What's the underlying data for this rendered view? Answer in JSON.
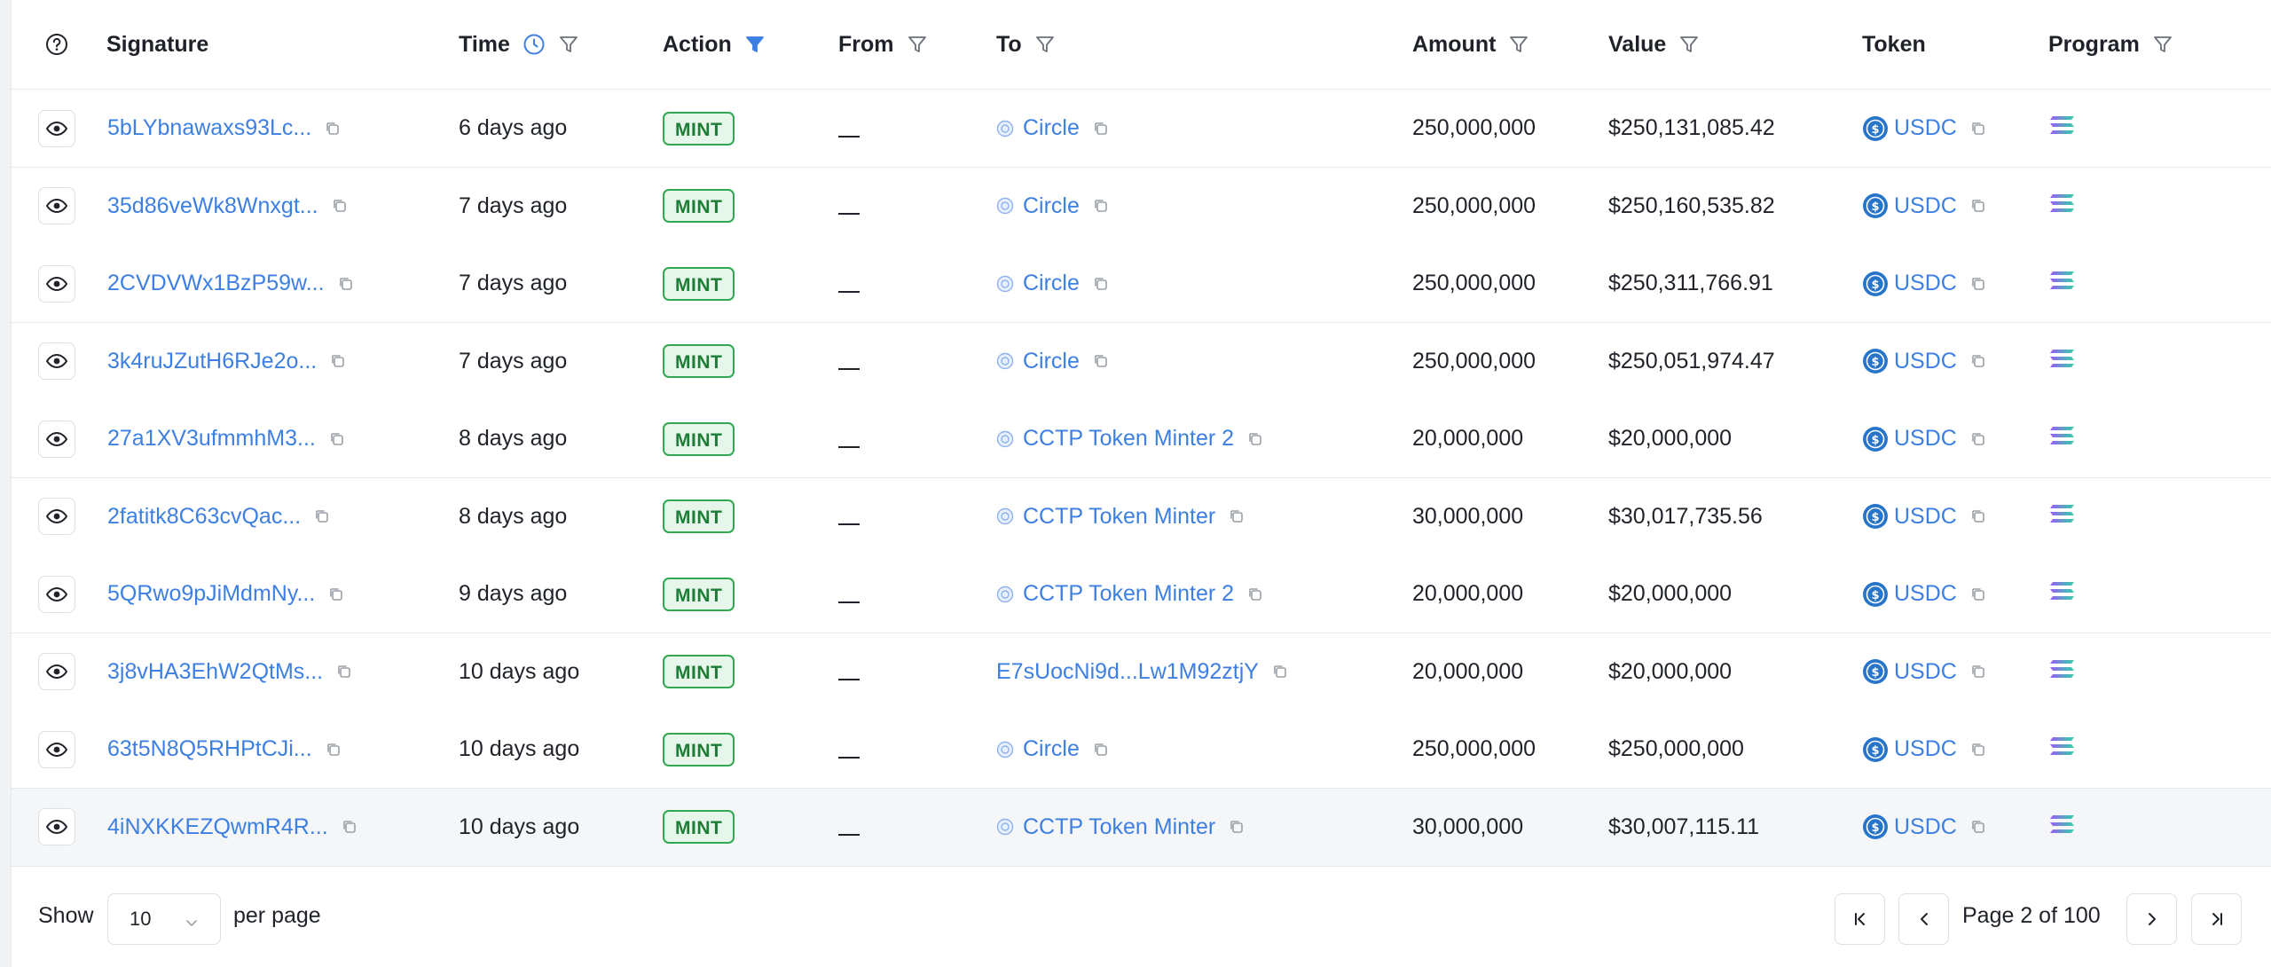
{
  "columns": {
    "signature": "Signature",
    "time": "Time",
    "action": "Action",
    "from": "From",
    "to": "To",
    "amount": "Amount",
    "value": "Value",
    "token": "Token",
    "program": "Program"
  },
  "icons": {
    "help": "help-circle-icon",
    "filter": "filter-icon",
    "filter_active": "filter-filled-icon",
    "clock": "clock-icon",
    "eye": "eye-icon",
    "copy": "copy-icon",
    "program": "solana-program-icon",
    "entity": "verified-entity-icon",
    "usdc": "usdc-token-icon"
  },
  "colors": {
    "link": "#3d7fe3",
    "badge_border": "#33a852",
    "badge_bg": "#e7f6ea",
    "filter_active": "#3d7fe3"
  },
  "rows": [
    {
      "signature": "5bLYbnawaxs93Lc...",
      "time": "6 days ago",
      "action": "MINT",
      "from": "__",
      "to": "Circle",
      "to_type": "entity",
      "amount": "250,000,000",
      "value": "$250,131,085.42",
      "token": "USDC"
    },
    {
      "signature": "35d86veWk8Wnxgt...",
      "time": "7 days ago",
      "action": "MINT",
      "from": "__",
      "to": "Circle",
      "to_type": "entity",
      "amount": "250,000,000",
      "value": "$250,160,535.82",
      "token": "USDC"
    },
    {
      "signature": "2CVDVWx1BzP59w...",
      "time": "7 days ago",
      "action": "MINT",
      "from": "__",
      "to": "Circle",
      "to_type": "entity",
      "amount": "250,000,000",
      "value": "$250,311,766.91",
      "token": "USDC"
    },
    {
      "signature": "3k4ruJZutH6RJe2o...",
      "time": "7 days ago",
      "action": "MINT",
      "from": "__",
      "to": "Circle",
      "to_type": "entity",
      "amount": "250,000,000",
      "value": "$250,051,974.47",
      "token": "USDC"
    },
    {
      "signature": "27a1XV3ufmmhM3...",
      "time": "8 days ago",
      "action": "MINT",
      "from": "__",
      "to": "CCTP Token Minter 2",
      "to_type": "entity",
      "amount": "20,000,000",
      "value": "$20,000,000",
      "token": "USDC"
    },
    {
      "signature": "2fatitk8C63cvQac...",
      "time": "8 days ago",
      "action": "MINT",
      "from": "__",
      "to": "CCTP Token Minter",
      "to_type": "entity",
      "amount": "30,000,000",
      "value": "$30,017,735.56",
      "token": "USDC"
    },
    {
      "signature": "5QRwo9pJiMdmNy...",
      "time": "9 days ago",
      "action": "MINT",
      "from": "__",
      "to": "CCTP Token Minter 2",
      "to_type": "entity",
      "amount": "20,000,000",
      "value": "$20,000,000",
      "token": "USDC"
    },
    {
      "signature": "3j8vHA3EhW2QtMs...",
      "time": "10 days ago",
      "action": "MINT",
      "from": "__",
      "to": "E7sUocNi9d...Lw1M92ztjY",
      "to_type": "address",
      "amount": "20,000,000",
      "value": "$20,000,000",
      "token": "USDC"
    },
    {
      "signature": "63t5N8Q5RHPtCJi...",
      "time": "10 days ago",
      "action": "MINT",
      "from": "__",
      "to": "Circle",
      "to_type": "entity",
      "amount": "250,000,000",
      "value": "$250,000,000",
      "token": "USDC"
    },
    {
      "signature": "4iNXKKEZQwmR4R...",
      "time": "10 days ago",
      "action": "MINT",
      "from": "__",
      "to": "CCTP Token Minter",
      "to_type": "entity",
      "amount": "30,000,000",
      "value": "$30,007,115.11",
      "token": "USDC"
    }
  ],
  "pagination": {
    "show_label": "Show",
    "per_page_value": "10",
    "per_page_label": "per page",
    "page_info": "Page 2 of 100"
  }
}
